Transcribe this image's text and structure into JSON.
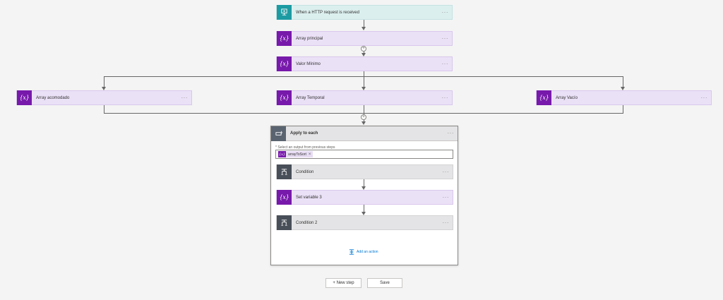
{
  "steps": {
    "trigger": {
      "label": "When a HTTP request is received",
      "icon": "http-request-icon"
    },
    "array_principal": {
      "label": "Array principal",
      "icon": "variable-icon"
    },
    "valor_minimo": {
      "label": "Valor Mínimo",
      "icon": "variable-icon"
    },
    "array_acomodado": {
      "label": "Array acomodado",
      "icon": "variable-icon"
    },
    "array_temporal": {
      "label": "Array Temporal",
      "icon": "variable-icon"
    },
    "array_vacio": {
      "label": "Array Vacío",
      "icon": "variable-icon"
    }
  },
  "apply_to_each": {
    "label": "Apply to each",
    "field_label": "* Select an output from previous steps",
    "token": "arrayToSort",
    "inner": {
      "condition": "Condition",
      "set_variable": "Set variable 3",
      "condition2": "Condition 2"
    },
    "add_action": "Add an action"
  },
  "menu_dots": "···",
  "variable_glyph": "{x}",
  "token_glyph": "{x}",
  "token_remove": "×",
  "footer": {
    "new_step": "+ New step",
    "save": "Save"
  },
  "colors": {
    "variable": "#7719aa",
    "http": "#1d9ba3",
    "condition": "#484f58",
    "link": "#0078d4"
  }
}
